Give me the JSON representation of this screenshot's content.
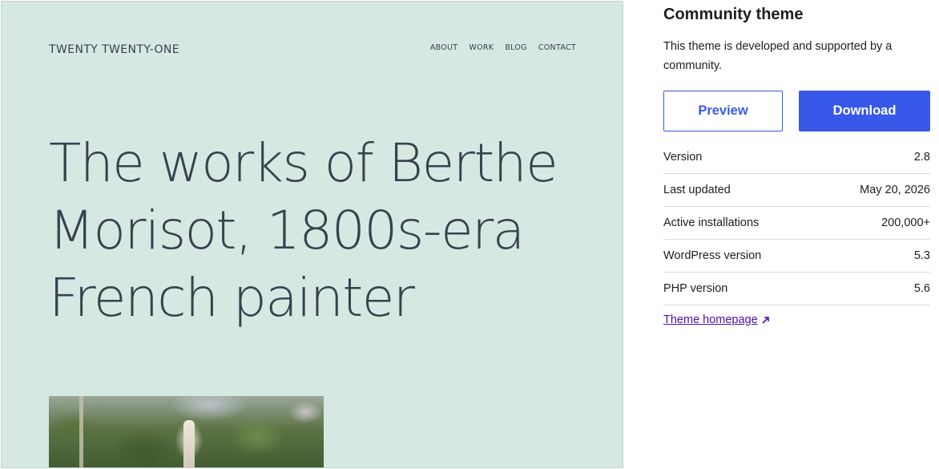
{
  "preview": {
    "site_title": "TWENTY TWENTY-ONE",
    "nav": [
      "ABOUT",
      "WORK",
      "BLOG",
      "CONTACT"
    ],
    "hero_lines": [
      "The works of Berthe",
      "Morisot, 1800s-era",
      "French painter"
    ]
  },
  "sidebar": {
    "title": "Community theme",
    "description": "This theme is developed and supported by a community.",
    "preview_label": "Preview",
    "download_label": "Download",
    "meta": [
      {
        "label": "Version",
        "value": "2.8"
      },
      {
        "label": "Last updated",
        "value": "May 20, 2026"
      },
      {
        "label": "Active installations",
        "value": "200,000+"
      },
      {
        "label": "WordPress version",
        "value": "5.3"
      },
      {
        "label": "PHP version",
        "value": "5.6"
      }
    ],
    "homepage_label": "Theme homepage",
    "homepage_icon": "external-link-icon"
  },
  "colors": {
    "accent": "#3858e9",
    "preview_bg": "#d6e8e2",
    "link": "#4b0fae"
  }
}
